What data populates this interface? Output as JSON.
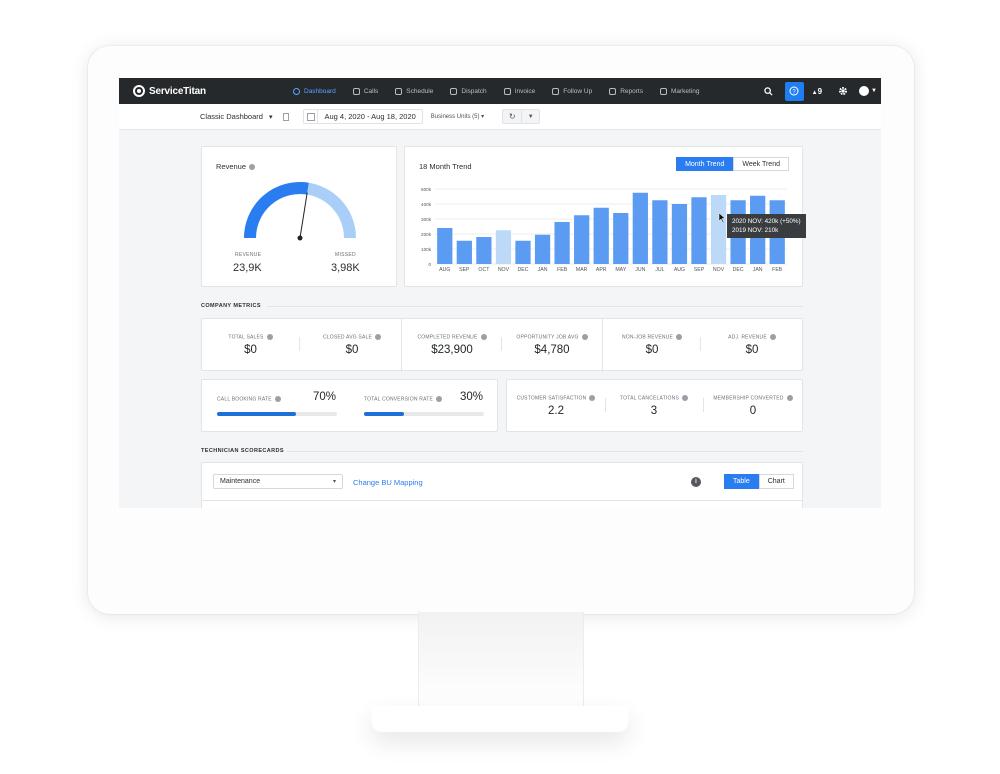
{
  "app": {
    "brand": "ServiceTitan"
  },
  "nav": {
    "items": [
      {
        "label": "Dashboard",
        "icon": "dashboard-icon",
        "active": true
      },
      {
        "label": "Calls",
        "icon": "phone-icon"
      },
      {
        "label": "Schedule",
        "icon": "calendar-icon"
      },
      {
        "label": "Dispatch",
        "icon": "truck-icon"
      },
      {
        "label": "Invoice",
        "icon": "invoice-icon"
      },
      {
        "label": "Follow Up",
        "icon": "flag-icon"
      },
      {
        "label": "Reports",
        "icon": "reports-icon"
      },
      {
        "label": "Marketing",
        "icon": "megaphone-icon"
      }
    ],
    "notification_count": "9"
  },
  "toolbar": {
    "dashboard_name": "Classic Dashboard",
    "date_range": "Aug 4, 2020 - Aug 18, 2020",
    "business_units": "Business Units (5)"
  },
  "revenue": {
    "title": "Revenue",
    "revenue_label": "REVENUE",
    "revenue_value": "23,9K",
    "missed_label": "MISSED",
    "missed_value": "3,98K",
    "gauge_fraction": 0.55
  },
  "trend": {
    "title": "18 Month Trend",
    "tab_month": "Month Trend",
    "tab_week": "Week Trend",
    "tooltip_line1": "2020 NOV: 420k (+50%)",
    "tooltip_line2": "2019 NOV: 210k"
  },
  "chart_data": {
    "type": "bar",
    "categories": [
      "AUG",
      "SEP",
      "OCT",
      "NOV",
      "DEC",
      "JAN",
      "FEB",
      "MAR",
      "APR",
      "MAY",
      "JUN",
      "JUL",
      "AUG",
      "SEP",
      "NOV",
      "DEC",
      "JAN",
      "FEB"
    ],
    "values": [
      240,
      155,
      180,
      225,
      155,
      195,
      280,
      325,
      375,
      340,
      475,
      425,
      400,
      445,
      460,
      425,
      455,
      425
    ],
    "highlighted": [
      3,
      14
    ],
    "yticks": [
      "0",
      "100k",
      "200k",
      "300k",
      "400k",
      "500k"
    ],
    "ylim": [
      0,
      500
    ],
    "colors": {
      "bar": "#5b9cf2",
      "highlight": "#bcdaf8"
    },
    "grid": true
  },
  "company_metrics": {
    "title": "COMPANY METRICS",
    "items": [
      {
        "label": "TOTAL SALES",
        "value": "$0"
      },
      {
        "label": "CLOSED AVG SALE",
        "value": "$0"
      },
      {
        "label": "COMPLETED REVENUE",
        "value": "$23,900"
      },
      {
        "label": "OPPORTUNITY JOB AVG",
        "value": "$4,780"
      },
      {
        "label": "NON-JOB REVENUE",
        "value": "$0"
      },
      {
        "label": "ADJ. REVENUE",
        "value": "$0"
      }
    ]
  },
  "rates": {
    "call_booking_label": "CALL BOOKING RATE",
    "call_booking_value": "70%",
    "call_booking_fraction": 0.66,
    "conversion_label": "TOTAL CONVERSION RATE",
    "conversion_value": "30%",
    "conversion_fraction": 0.33
  },
  "satisfaction": [
    {
      "label": "CUSTOMER SATISFACTION",
      "value": "2.2"
    },
    {
      "label": "TOTAL CANCELATIONS",
      "value": "3"
    },
    {
      "label": "MEMBERSHIP CONVERTED",
      "value": "0"
    }
  ],
  "technician": {
    "title": "TECHNICIAN SCORECARDS",
    "select_value": "Maintenance",
    "bu_link": "Change BU Mapping",
    "info": "i",
    "view_table": "Table",
    "view_chart": "Chart"
  }
}
